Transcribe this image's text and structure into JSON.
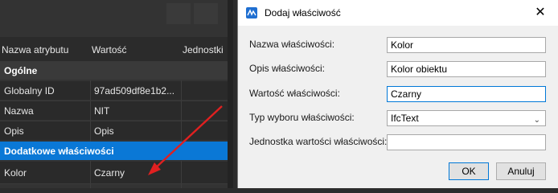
{
  "properties_panel": {
    "columns": {
      "name": "Nazwa atrybutu",
      "value": "Wartość",
      "units": "Jednostki"
    },
    "rows": [
      {
        "type": "group",
        "name": "Ogólne"
      },
      {
        "type": "item",
        "name": "Globalny ID",
        "value": "97ad509df8e1b2..."
      },
      {
        "type": "item",
        "name": "Nazwa",
        "value": "NIT"
      },
      {
        "type": "item",
        "name": "Opis",
        "value": "Opis"
      },
      {
        "type": "group",
        "name": "Dodatkowe właściwości",
        "selected": true
      },
      {
        "type": "item",
        "name": "Kolor",
        "value": "Czarny"
      }
    ]
  },
  "dialog": {
    "title": "Dodaj właściwość",
    "close_glyph": "✕",
    "fields": {
      "name": {
        "label": "Nazwa właściwości:",
        "value": "Kolor"
      },
      "description": {
        "label": "Opis właściwości:",
        "value": "Kolor obiektu"
      },
      "value": {
        "label": "Wartość właściwości:",
        "value": "Czarny"
      },
      "type": {
        "label": "Typ wyboru właściwości:",
        "selected": "IfcText"
      },
      "unit": {
        "label": "Jednostka wartości właściwości:",
        "value": ""
      }
    },
    "ok_label": "OK",
    "cancel_label": "Anuluj"
  },
  "colors": {
    "accent": "#0078d7",
    "selection": "#0a78d6",
    "annotation_arrow": "#e02020"
  },
  "icons": {
    "app": "app-logo-icon",
    "close": "close-icon",
    "dropdown": "chevron-down-icon"
  }
}
